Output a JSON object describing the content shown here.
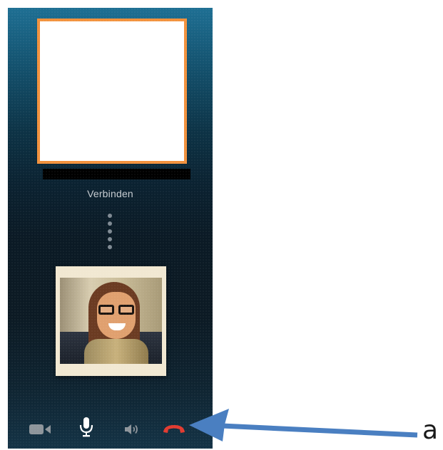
{
  "call": {
    "status_text": "Verbinden"
  },
  "toolbar": {
    "buttons": [
      {
        "name": "video",
        "icon": "video-camera-icon",
        "color": "#8e959b"
      },
      {
        "name": "microphone",
        "icon": "microphone-icon",
        "color": "#ffffff"
      },
      {
        "name": "speaker",
        "icon": "speaker-icon",
        "color": "#8e959b"
      },
      {
        "name": "end-call",
        "icon": "hang-up-icon",
        "color": "#e23b30"
      }
    ]
  },
  "annotation": {
    "label": "a",
    "arrow_color": "#4a7fc1"
  },
  "colors": {
    "callee_frame": "#f2913d"
  }
}
